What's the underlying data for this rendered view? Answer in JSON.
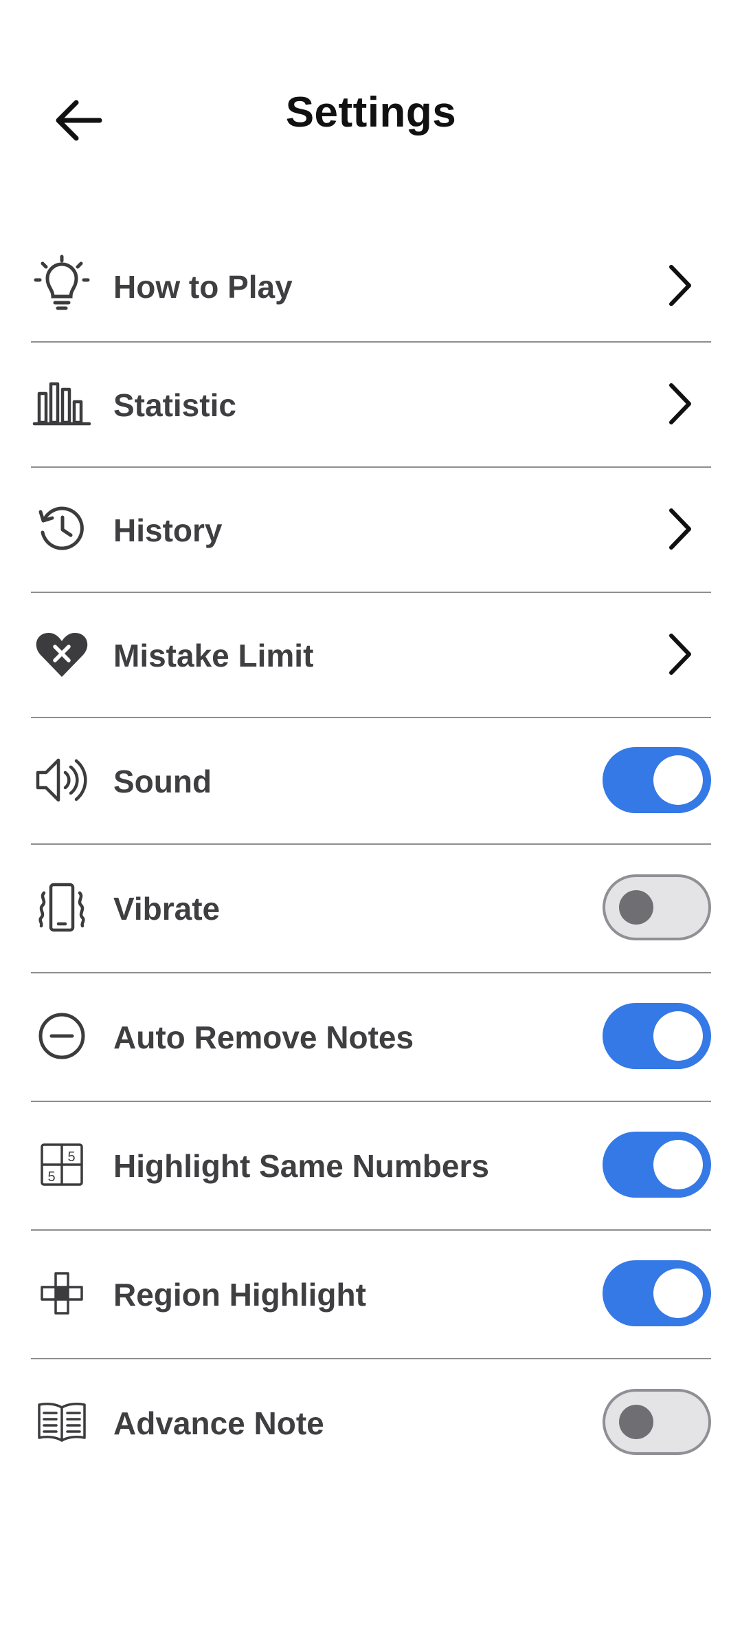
{
  "header": {
    "title": "Settings"
  },
  "items": [
    {
      "label": "How to Play",
      "icon": "lightbulb-icon",
      "control": "chevron"
    },
    {
      "label": "Statistic",
      "icon": "bar-chart-icon",
      "control": "chevron"
    },
    {
      "label": "History",
      "icon": "history-clock-icon",
      "control": "chevron"
    },
    {
      "label": "Mistake Limit",
      "icon": "heart-x-icon",
      "control": "chevron"
    },
    {
      "label": "Sound",
      "icon": "speaker-icon",
      "control": "toggle",
      "on": true
    },
    {
      "label": "Vibrate",
      "icon": "phone-vibrate-icon",
      "control": "toggle",
      "on": false
    },
    {
      "label": "Auto Remove Notes",
      "icon": "minus-circle-icon",
      "control": "toggle",
      "on": true
    },
    {
      "label": "Highlight Same Numbers",
      "icon": "grid-numbers-icon",
      "control": "toggle",
      "on": true
    },
    {
      "label": "Region Highlight",
      "icon": "region-cross-icon",
      "control": "toggle",
      "on": true
    },
    {
      "label": "Advance Note",
      "icon": "open-book-icon",
      "control": "toggle",
      "on": false
    }
  ],
  "grid_icon_digits": [
    "5",
    "5"
  ],
  "colors": {
    "accent": "#3479e5",
    "toggle_off_bg": "#e4e4e6",
    "toggle_off_knob": "#6f6f73",
    "text": "#3f3f42",
    "divider": "#8e8e8e"
  }
}
